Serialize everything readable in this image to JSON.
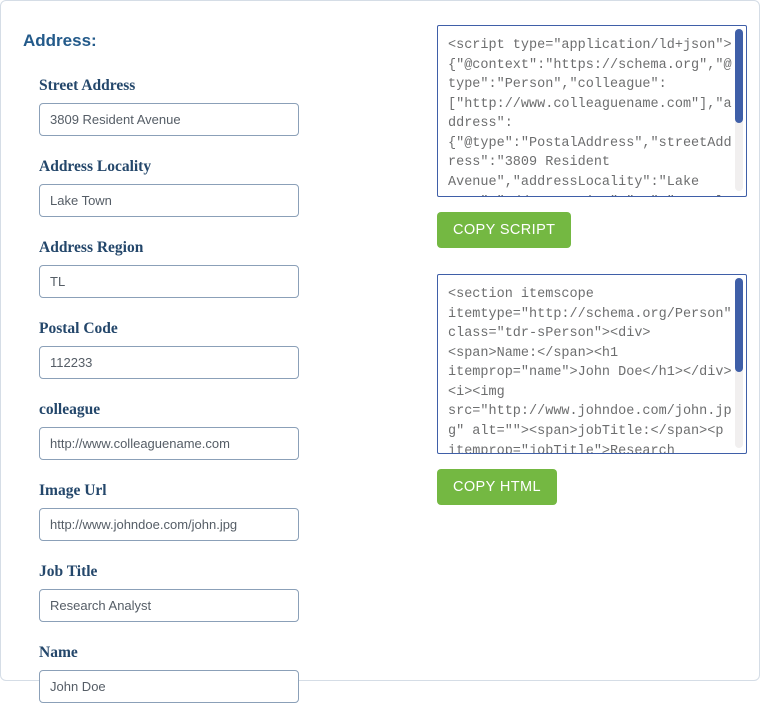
{
  "section_heading": "Address:",
  "fields": {
    "street_address": {
      "label": "Street Address",
      "value": "3809 Resident Avenue"
    },
    "address_locality": {
      "label": "Address Locality",
      "value": "Lake Town"
    },
    "address_region": {
      "label": "Address Region",
      "value": "TL"
    },
    "postal_code": {
      "label": "Postal Code",
      "value": "112233"
    },
    "colleague": {
      "label": "colleague",
      "value": "http://www.colleaguename.com"
    },
    "image_url": {
      "label": "Image Url",
      "value": "http://www.johndoe.com/john.jpg"
    },
    "job_title": {
      "label": "Job Title",
      "value": "Research Analyst"
    },
    "name": {
      "label": "Name",
      "value": "John Doe"
    }
  },
  "script_output": "<script type=\"application/ld+json\">{\"@context\":\"https://schema.org\",\"@type\":\"Person\",\"colleague\":[\"http://www.colleaguename.com\"],\"address\":{\"@type\":\"PostalAddress\",\"streetAddress\":\"3809 Resident Avenue\",\"addressLocality\":\"Lake Town\",\"addressRegion\":\"TL\",\"postalCo",
  "html_output": "<section itemscope itemtype=\"http://schema.org/Person\" class=\"tdr-sPerson\"><div><span>Name:</span><h1 itemprop=\"name\">John Doe</h1></div><i><img src=\"http://www.johndoe.com/john.jpg\" alt=\"\"><span>jobTitle:</span><p itemprop=\"jobTitle\">Research Analystn</p><span>streetAddress:",
  "buttons": {
    "copy_script": "COPY SCRIPT",
    "copy_html": "COPY HTML"
  }
}
